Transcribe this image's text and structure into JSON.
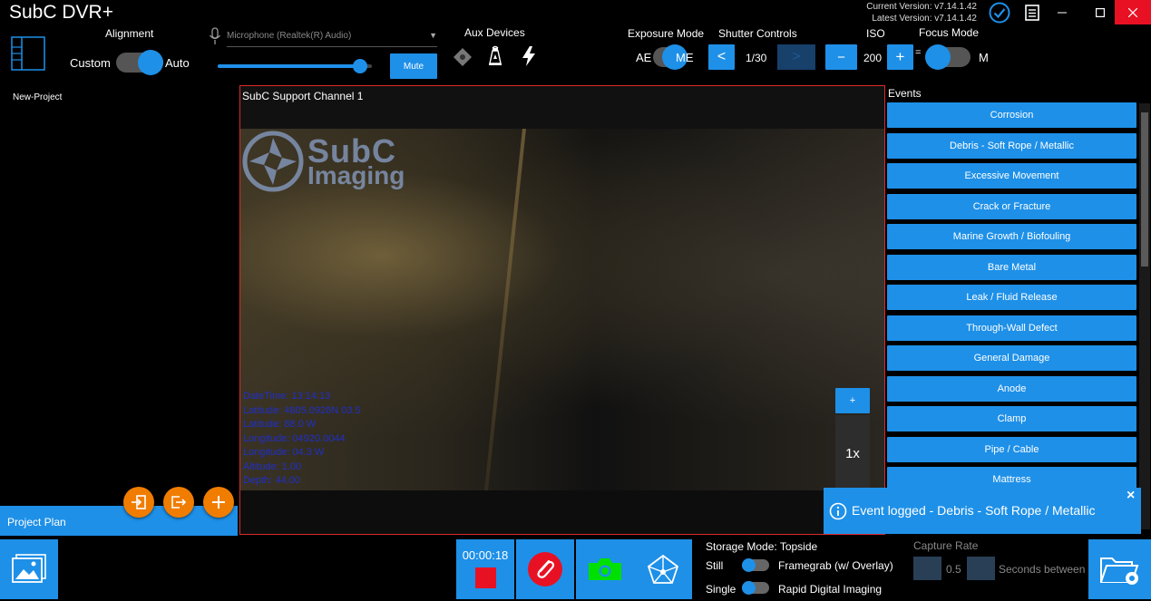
{
  "app": {
    "title": "SubC DVR+",
    "current_version": "Current Version: v7.14.1.42",
    "latest_version": "Latest Version: v7.14.1.42"
  },
  "alignment": {
    "label": "Alignment",
    "left": "Custom",
    "right": "Auto"
  },
  "audio": {
    "microphone": "Microphone (Realtek(R) Audio)",
    "mute_label": "Mute",
    "volume_level": 0.97
  },
  "aux": {
    "label": "Aux Devices"
  },
  "exposure": {
    "label": "Exposure Mode",
    "left": "AE",
    "right": "ME"
  },
  "shutter": {
    "label": "Shutter Controls",
    "value": "1/30",
    "prev": "<",
    "next": ">"
  },
  "iso": {
    "label": "ISO",
    "value": "200",
    "minus": "−",
    "plus": "+"
  },
  "focus": {
    "label": "Focus Mode",
    "left": "=",
    "right": "M"
  },
  "project": {
    "name": "New-Project",
    "plan_label": "Project Plan"
  },
  "video": {
    "channel": "SubC Support Channel 1",
    "watermark_top": "SubC",
    "watermark_bottom": "Imaging",
    "overlay": [
      "DateTime: 13:14:13",
      "Latitude: 4805.0928N 03.5",
      "Latitude: 88.0 W",
      "Longitude: 04920.0044",
      "Longitude: 04.3 W",
      "Altitude: 1.00",
      "Depth: 44.00"
    ],
    "zoom_plus": "+",
    "zoom_level": "1x"
  },
  "events": {
    "title": "Events",
    "items": [
      "Corrosion",
      "Debris - Soft Rope / Metallic",
      "Excessive Movement",
      "Crack or Fracture",
      "Marine Growth / Biofouling",
      "Bare Metal",
      "Leak / Fluid Release",
      "Through-Wall Defect",
      "General Damage",
      "Anode",
      "Clamp",
      "Pipe / Cable",
      "Mattress"
    ]
  },
  "toast": {
    "message": "Event logged - Debris - Soft Rope / Metallic",
    "close": "×"
  },
  "recording": {
    "timer": "00:00:18"
  },
  "storage": {
    "mode": "Storage Mode: Topside",
    "still": "Still",
    "still_option": "Framegrab (w/ Overlay)",
    "single": "Single",
    "single_option": "Rapid Digital Imaging"
  },
  "capture_rate": {
    "label": "Capture Rate",
    "value": "0.5",
    "unit": "Seconds between s"
  },
  "colors": {
    "accent": "#1e90e8",
    "record_red": "#e81123",
    "snapshot_green": "#00e000",
    "fab_orange": "#f07d00"
  }
}
